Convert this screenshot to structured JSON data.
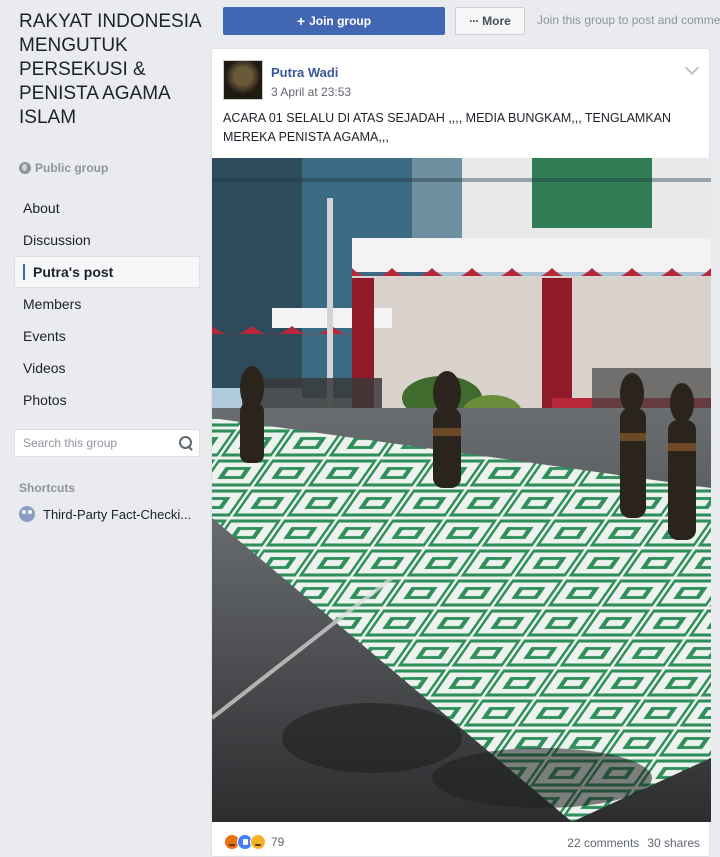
{
  "group": {
    "name": "RAKYAT INDONESIA MENGUTUK PERSEKUSI & PENISTA AGAMA ISLAM",
    "privacy": "Public group"
  },
  "nav": {
    "items": [
      {
        "label": "About"
      },
      {
        "label": "Discussion"
      },
      {
        "label": "Putra's post",
        "active": true
      },
      {
        "label": "Members"
      },
      {
        "label": "Events"
      },
      {
        "label": "Videos"
      },
      {
        "label": "Photos"
      }
    ]
  },
  "search": {
    "placeholder": "Search this group"
  },
  "shortcuts": {
    "heading": "Shortcuts",
    "items": [
      {
        "label": "Third-Party Fact-Checki..."
      }
    ]
  },
  "topbar": {
    "join_label": "Join group",
    "join_icon": "+",
    "more_label": "More",
    "more_icon": "···",
    "hint": "Join this group to post and comme"
  },
  "post": {
    "author": "Putra Wadi",
    "timestamp": "3 April at 23:53",
    "text": "ACARA 01 SELALU DI ATAS SEJADAH ,,,, MEDIA BUNGKAM,,, TENGLAMKAN MEREKA PENISTA AGAMA,,,",
    "reaction_count": "79",
    "comments": "22 comments",
    "shares": "30 shares"
  },
  "colors": {
    "brand": "#4267b2",
    "link": "#385898",
    "background": "#e9ebee"
  }
}
